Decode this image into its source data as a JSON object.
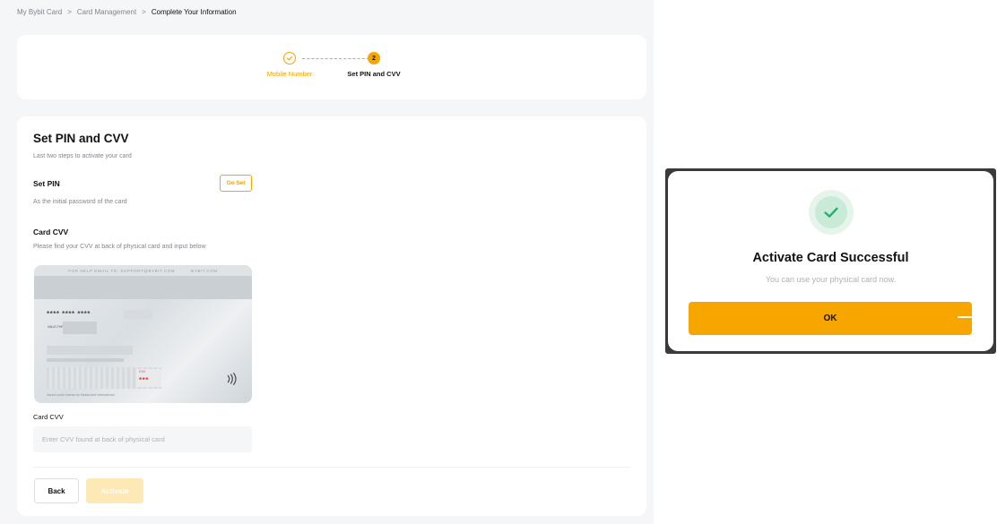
{
  "breadcrumb": {
    "items": [
      "My Bybit Card",
      "Card Management",
      "Complete Your Information"
    ],
    "separator": ">"
  },
  "stepper": {
    "steps": [
      {
        "index": "1",
        "label": "Mobile Number",
        "state": "completed"
      },
      {
        "index": "2",
        "label": "Set PIN and CVV",
        "state": "active"
      }
    ]
  },
  "main": {
    "title": "Set PIN and CVV",
    "subtitle": "Last two steps to activate your card",
    "set_pin": {
      "label": "Set PIN",
      "description": "As the initial password of the card",
      "button": "Go Set"
    },
    "card_cvv": {
      "label": "Card CVV",
      "description": "Please find your CVV at back of physical card and input below"
    },
    "card_image": {
      "band_text": "FOR HELP EMAIL TO: SUPPORT@BYBIT.COM",
      "band_brand": "BYBIT.COM",
      "masked_number": "**** **** ****",
      "valid_thru": "VALID THRU",
      "cvv_tag": "CVV",
      "cvv_stars": "***",
      "license": "Issued under license by Mastercard International"
    },
    "cvv_field": {
      "label": "Card CVV",
      "value": "",
      "placeholder": "Enter CVV found at back of physical card"
    },
    "back_button": "Back",
    "activate_button": "Activate"
  },
  "dialog": {
    "title": "Activate Card Successful",
    "subtitle": "You can use your physical card now.",
    "ok_button": "OK"
  },
  "colors": {
    "accent": "#f7a600",
    "success": "#20b26c",
    "disabled_accent": "#fde9b6"
  },
  "icons": {
    "step1": "check-icon",
    "success": "check-circle-icon",
    "contactless": "contactless-icon"
  }
}
